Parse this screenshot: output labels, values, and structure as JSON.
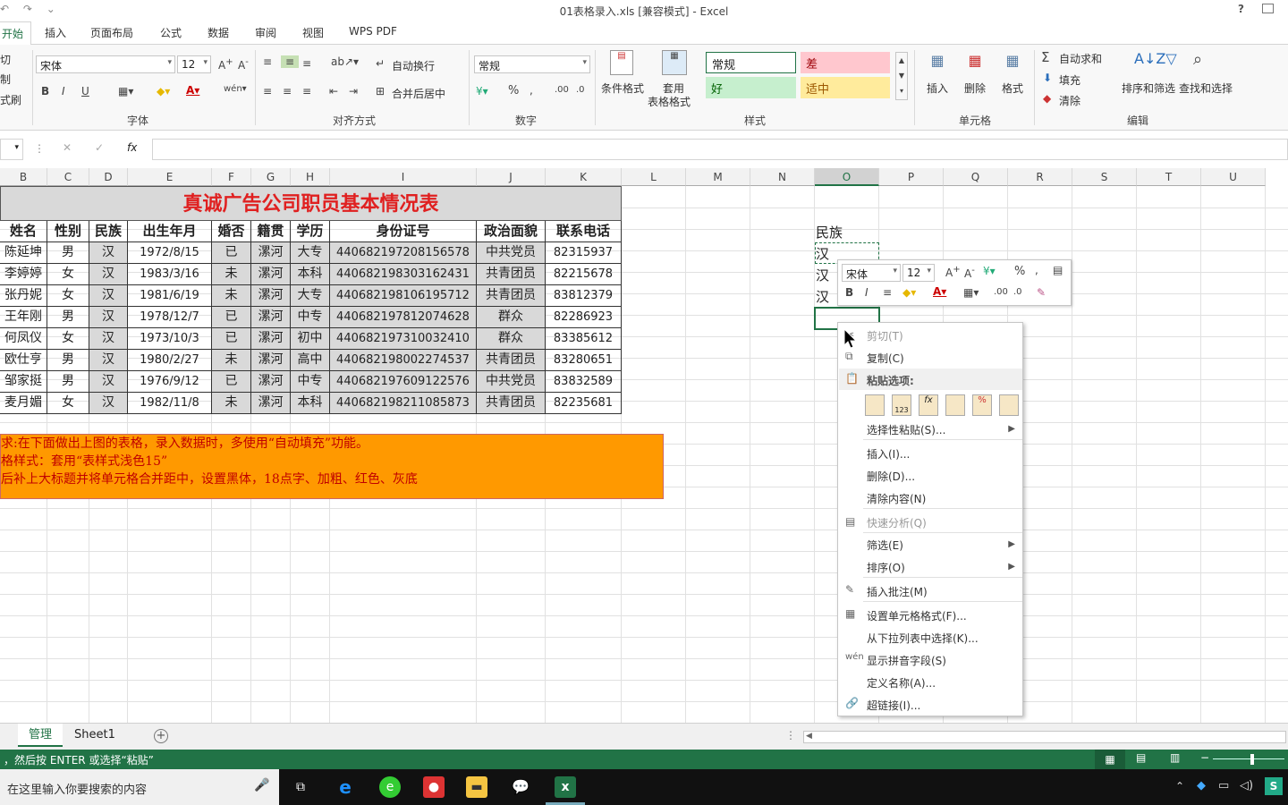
{
  "window": {
    "title": "01表格录入.xls  [兼容模式] - Excel",
    "help": "?"
  },
  "tabs": [
    "开始",
    "插入",
    "页面布局",
    "公式",
    "数据",
    "审阅",
    "视图",
    "WPS PDF"
  ],
  "ribbon": {
    "clipboard": {
      "cut": "切",
      "copy": "制",
      "format": "式刷"
    },
    "font": {
      "name": "宋体",
      "size": "12",
      "label": "字体",
      "bold": "B",
      "italic": "I",
      "underline": "U"
    },
    "align": {
      "wrap": "自动换行",
      "merge": "合并后居中",
      "label": "对齐方式"
    },
    "number": {
      "format": "常规",
      "label": "数字",
      "percent": "%"
    },
    "styles": {
      "cond": "条件格式",
      "table1": "套用",
      "table2": "表格格式",
      "normal": "常规",
      "bad": "差",
      "good": "好",
      "neutral": "适中",
      "label": "样式"
    },
    "cells": {
      "insert": "插入",
      "delete": "删除",
      "format": "格式",
      "label": "单元格"
    },
    "editing": {
      "autosum": "自动求和",
      "fill": "填充",
      "clear": "清除",
      "sort": "排序和筛选",
      "find": "查找和选择",
      "label": "编辑"
    }
  },
  "formula": {
    "fx": "fx",
    "cancel": "✕",
    "enter": "✓"
  },
  "columns": [
    "B",
    "C",
    "D",
    "E",
    "F",
    "G",
    "H",
    "I",
    "J",
    "K",
    "L",
    "M",
    "N",
    "O",
    "P",
    "Q",
    "R",
    "S",
    "T",
    "U"
  ],
  "selected_column": "O",
  "table": {
    "title": "真诚广告公司职员基本情况表",
    "headers": [
      "姓名",
      "性别",
      "民族",
      "出生年月",
      "婚否",
      "籍贯",
      "学历",
      "身份证号",
      "政治面貌",
      "联系电话"
    ],
    "rows": [
      [
        "陈延坤",
        "男",
        "汉",
        "1972/8/15",
        "已",
        "漯河",
        "大专",
        "440682197208156578",
        "中共党员",
        "82315937"
      ],
      [
        "李婷婷",
        "女",
        "汉",
        "1983/3/16",
        "未",
        "漯河",
        "本科",
        "440682198303162431",
        "共青团员",
        "82215678"
      ],
      [
        "张丹妮",
        "女",
        "汉",
        "1981/6/19",
        "未",
        "漯河",
        "大专",
        "440682198106195712",
        "共青团员",
        "83812379"
      ],
      [
        "王年刚",
        "男",
        "汉",
        "1978/12/7",
        "已",
        "漯河",
        "中专",
        "440682197812074628",
        "群众",
        "82286923"
      ],
      [
        "何凤仪",
        "女",
        "汉",
        "1973/10/3",
        "已",
        "漯河",
        "初中",
        "440682197310032410",
        "群众",
        "83385612"
      ],
      [
        "欧仕亨",
        "男",
        "汉",
        "1980/2/27",
        "未",
        "漯河",
        "高中",
        "440682198002274537",
        "共青团员",
        "83280651"
      ],
      [
        "邹家挺",
        "男",
        "汉",
        "1976/9/12",
        "已",
        "漯河",
        "中专",
        "440682197609122576",
        "中共党员",
        "83832589"
      ],
      [
        "麦月媚",
        "女",
        "汉",
        "1982/11/8",
        "未",
        "漯河",
        "本科",
        "440682198211085873",
        "共青团员",
        "82235681"
      ]
    ]
  },
  "note": [
    "求:在下面做出上图的表格，录入数据时，多使用“自动填充”功能。",
    "格样式：套用“表样式浅色15”",
    "后补上大标题并将单元格合并距中，设置黑体，18点字、加粗、红色、灰底"
  ],
  "o_column": {
    "header": "民族",
    "values": [
      "汉",
      "汉",
      "汉"
    ]
  },
  "mini_toolbar": {
    "font": "宋体",
    "size": "12",
    "percent": "%",
    "bold": "B",
    "italic": "I"
  },
  "context_menu": [
    {
      "label": "剪切(T)",
      "disabled": true
    },
    {
      "label": "复制(C)",
      "disabled": false
    },
    {
      "label": "粘贴选项:",
      "disabled": false
    },
    {
      "label": "选择性粘贴(S)...",
      "disabled": false
    },
    {
      "label": "插入(I)...",
      "disabled": false
    },
    {
      "label": "删除(D)...",
      "disabled": false
    },
    {
      "label": "清除内容(N)",
      "disabled": false
    },
    {
      "label": "快速分析(Q)",
      "disabled": true
    },
    {
      "label": "筛选(E)",
      "disabled": false
    },
    {
      "label": "排序(O)",
      "disabled": false
    },
    {
      "label": "插入批注(M)",
      "disabled": false
    },
    {
      "label": "设置单元格格式(F)...",
      "disabled": false
    },
    {
      "label": "从下拉列表中选择(K)...",
      "disabled": false
    },
    {
      "label": "显示拼音字段(S)",
      "disabled": false
    },
    {
      "label": "定义名称(A)...",
      "disabled": false
    },
    {
      "label": "超链接(I)...",
      "disabled": false
    }
  ],
  "sheets": [
    "管理",
    "Sheet1"
  ],
  "active_sheet": "管理",
  "status_text": "，然后按 ENTER 或选择“粘贴”",
  "taskbar": {
    "search": "在这里输入你要搜索的内容"
  },
  "colors": {
    "accent": "#217346",
    "title_red": "#e02020",
    "note_bg": "#ff9900",
    "note_text": "#c00000"
  }
}
